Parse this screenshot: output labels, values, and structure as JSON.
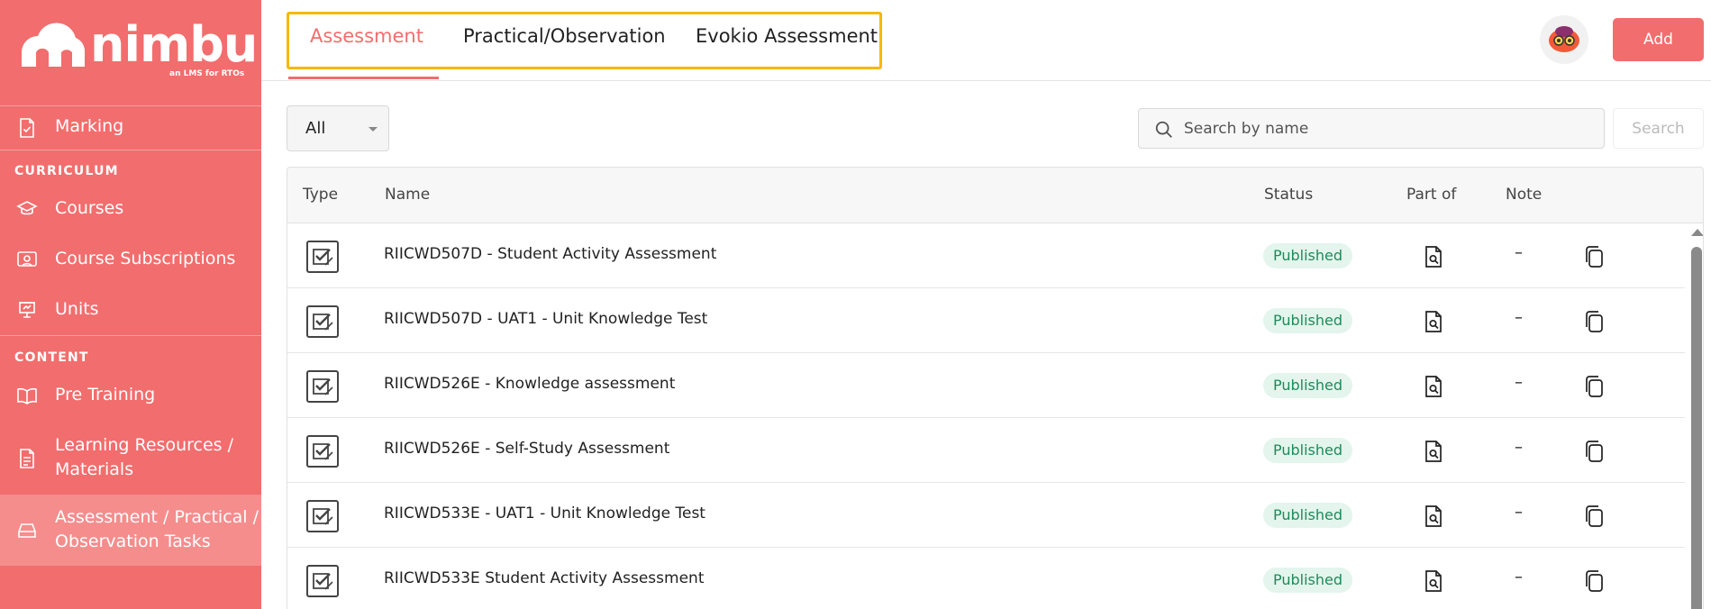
{
  "brand": {
    "name": "nimbu",
    "tagline": "an LMS for RTOs"
  },
  "sidebar": {
    "items": [
      {
        "label": "Marking",
        "icon": "file-check-icon"
      },
      {
        "section": "CURRICULUM"
      },
      {
        "label": "Courses",
        "icon": "graduation-cap-icon"
      },
      {
        "label": "Course Subscriptions",
        "icon": "id-card-icon"
      },
      {
        "label": "Units",
        "icon": "presentation-board-icon"
      },
      {
        "section": "CONTENT"
      },
      {
        "label": "Pre Training",
        "icon": "open-book-icon"
      },
      {
        "label": "Learning Resources / Materials",
        "icon": "document-icon"
      },
      {
        "label": "Assessment / Practical / Observation Tasks",
        "icon": "tray-icon"
      }
    ],
    "labels": {
      "marking": "Marking",
      "curriculum": "CURRICULUM",
      "courses": "Courses",
      "subscriptions": "Course Subscriptions",
      "units": "Units",
      "content": "CONTENT",
      "pretraining": "Pre Training",
      "learning_1": "Learning Resources /",
      "learning_2": "Materials",
      "assessment_1": "Assessment / Practical /",
      "assessment_2": "Observation Tasks"
    }
  },
  "tabs": {
    "assessment": "Assessment",
    "practical": "Practical/Observation",
    "evokio": "Evokio Assessment",
    "active": "Assessment"
  },
  "header": {
    "add_label": "Add"
  },
  "filters": {
    "type_value": "All",
    "search_placeholder": "Search by name",
    "search_label": "Search"
  },
  "table": {
    "columns": {
      "type": "Type",
      "name": "Name",
      "status": "Status",
      "partof": "Part of",
      "note": "Note"
    },
    "rows": [
      {
        "name": "RIICWD507D - Student Activity Assessment",
        "status": "Published",
        "note": "–"
      },
      {
        "name": "RIICWD507D - UAT1 - Unit Knowledge Test",
        "status": "Published",
        "note": "–"
      },
      {
        "name": "RIICWD526E - Knowledge assessment",
        "status": "Published",
        "note": "–"
      },
      {
        "name": "RIICWD526E - Self-Study Assessment",
        "status": "Published",
        "note": "–"
      },
      {
        "name": "RIICWD533E - UAT1 - Unit Knowledge Test",
        "status": "Published",
        "note": "–"
      },
      {
        "name": "RIICWD533E Student Activity Assessment",
        "status": "Published",
        "note": "–"
      }
    ]
  },
  "colors": {
    "brand": "#f26d6d",
    "highlight_box": "#f5b800",
    "published_bg": "#e3f5ec",
    "published_text": "#1e8b5a"
  }
}
